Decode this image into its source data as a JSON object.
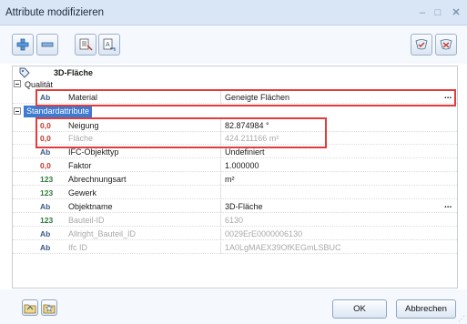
{
  "window": {
    "title": "Attribute modifizieren",
    "minimize_glyph": "–",
    "maximize_glyph": "□",
    "close_glyph": "✕"
  },
  "toolbar": {
    "buttons": [
      {
        "icon": "add-attribute-icon"
      },
      {
        "icon": "remove-attribute-icon"
      },
      {
        "icon": "pick-attribute-icon"
      },
      {
        "icon": "match-attribute-icon"
      },
      {
        "icon": "favorites-icon"
      },
      {
        "icon": "favorites-delete-icon"
      }
    ]
  },
  "object": {
    "title": "3D-Fläche",
    "icon": "tag-icon"
  },
  "groups": {
    "qualitaet": "Qualität",
    "standard": "Standardattribute"
  },
  "rows": [
    {
      "type": "Ab",
      "name": "Material",
      "value": "Geneigte Flächen",
      "dots": "..."
    },
    {
      "type": "0,0",
      "name": "Neigung",
      "value": "82.874984 °"
    },
    {
      "type": "0,0",
      "name": "Fläche",
      "value": "424.211166 m²"
    },
    {
      "type": "Ab",
      "name": "IFC-Objekttyp",
      "value": "Undefiniert"
    },
    {
      "type": "0,0",
      "name": "Faktor",
      "value": "1.000000"
    },
    {
      "type": "123",
      "name": "Abrechnungsart",
      "value": "m²"
    },
    {
      "type": "123",
      "name": "Gewerk",
      "value": ""
    },
    {
      "type": "Ab",
      "name": "Objektname",
      "value": "3D-Fläche",
      "dots": "..."
    },
    {
      "type": "123",
      "name": "Bauteil-ID",
      "value": "6130"
    },
    {
      "type": "Ab",
      "name": "Allright_Bauteil_ID",
      "value": "0029ErE0000006130"
    },
    {
      "type": "Ab",
      "name": "Ifc ID",
      "value": "1A0LgMAEX39OfKEGmLSBUC"
    }
  ],
  "footer": {
    "ok_label": "OK",
    "cancel_label": "Abbrechen",
    "left_icons": [
      "open-folder-icon",
      "save-folder-icon"
    ]
  },
  "colors": {
    "highlight": "#e23c3c",
    "selection": "#3d7ad1",
    "title_bar": "#d9e6f6"
  }
}
